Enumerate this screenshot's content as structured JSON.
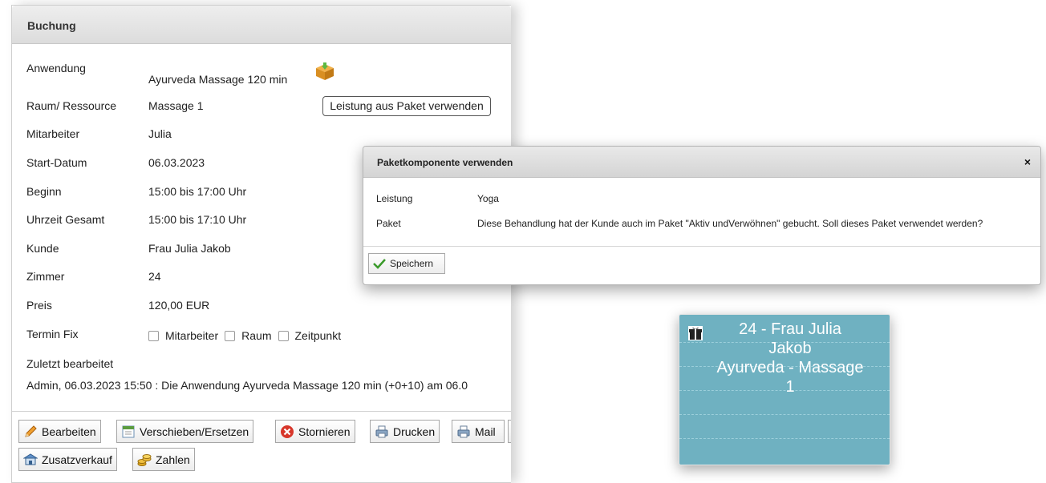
{
  "booking": {
    "title": "Buchung",
    "fields": {
      "anwendung": {
        "label": "Anwendung",
        "value": "Ayurveda Massage 120 min"
      },
      "raum": {
        "label": "Raum/ Ressource",
        "value": "Massage 1"
      },
      "mitarbeiter": {
        "label": "Mitarbeiter",
        "value": "Julia"
      },
      "start_datum": {
        "label": "Start-Datum",
        "value": "06.03.2023"
      },
      "beginn": {
        "label": "Beginn",
        "value": "15:00 bis 17:00 Uhr"
      },
      "uhrzeit_gesamt": {
        "label": "Uhrzeit Gesamt",
        "value": "15:00 bis 17:10 Uhr"
      },
      "kunde": {
        "label": "Kunde",
        "value": "Frau Julia Jakob"
      },
      "zimmer": {
        "label": "Zimmer",
        "value": "24"
      },
      "preis": {
        "label": "Preis",
        "value": "120,00 EUR"
      }
    },
    "package_button": "Leistung aus Paket verwenden",
    "termin_fix": {
      "label": "Termin Fix",
      "options": [
        {
          "label": "Mitarbeiter",
          "checked": false
        },
        {
          "label": "Raum",
          "checked": false
        },
        {
          "label": "Zeitpunkt",
          "checked": false
        }
      ]
    },
    "last_edited": {
      "label": "Zuletzt bearbeitet",
      "text": "Admin, 06.03.2023 15:50 : Die Anwendung Ayurveda Massage 120 min (+0+10) am 06.0"
    },
    "buttons": {
      "edit": "Bearbeiten",
      "move": "Verschieben/Ersetzen",
      "cancel": "Stornieren",
      "print": "Drucken",
      "mail": "Mail",
      "extra_sale": "Zusatzverkauf",
      "pay": "Zahlen"
    }
  },
  "dialog": {
    "title": "Paketkomponente verwenden",
    "close": "×",
    "rows": {
      "leistung": {
        "label": "Leistung",
        "value": "Yoga"
      },
      "paket": {
        "label": "Paket",
        "value": "Diese Behandlung hat der Kunde auch im Paket \"Aktiv undVerwöhnen\" gebucht. Soll dieses Paket verwendet werden?"
      }
    },
    "save_button": "Speichern"
  },
  "calendar_card": {
    "line1": "24 - Frau Julia",
    "line2": "Jakob",
    "line3": "Ayurveda - Massage",
    "line4": "1",
    "color": "#6fb1c1"
  }
}
